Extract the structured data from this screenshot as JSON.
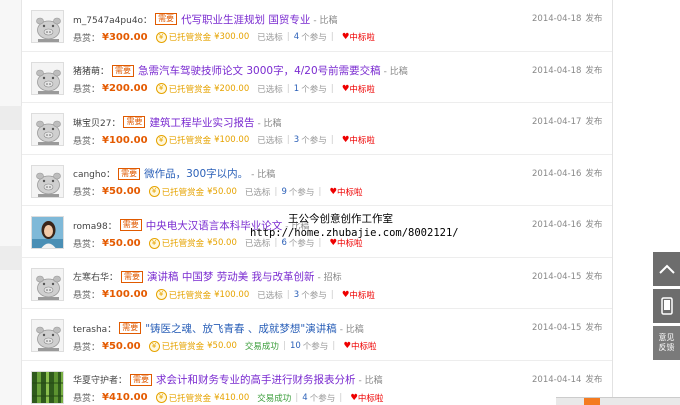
{
  "tasks": [
    {
      "user": "m_7547a4pu4o：",
      "tag": "需要",
      "title": "代写职业生涯规划 国贸专业",
      "status": "- 比稿",
      "date": "2014-04-18",
      "publish": "发布",
      "reward_label": "悬赏：",
      "reward": "¥300.00",
      "escrow": "已托管赏金",
      "escrow_amount": "¥300.00",
      "selection": "已选标",
      "count": "4",
      "count_label": "个参与",
      "heart": "♥",
      "win": "中标啦",
      "title_color": "purple",
      "avatar": "pig"
    },
    {
      "user": "猪猪萌：",
      "tag": "需要",
      "title": "急需汽车驾驶技师论文 3000字，4/20号前需要交稿",
      "status": "- 比稿",
      "date": "2014-04-18",
      "publish": "发布",
      "reward_label": "悬赏：",
      "reward": "¥200.00",
      "escrow": "已托管赏金",
      "escrow_amount": "¥200.00",
      "selection": "已选标",
      "count": "1",
      "count_label": "个参与",
      "heart": "♥",
      "win": "中标啦",
      "title_color": "purple",
      "avatar": "pig"
    },
    {
      "user": "琳宝贝27：",
      "tag": "需要",
      "title": "建筑工程毕业实习报告",
      "status": "- 比稿",
      "date": "2014-04-17",
      "publish": "发布",
      "reward_label": "悬赏：",
      "reward": "¥100.00",
      "escrow": "已托管赏金",
      "escrow_amount": "¥100.00",
      "selection": "已选标",
      "count": "3",
      "count_label": "个参与",
      "heart": "♥",
      "win": "中标啦",
      "title_color": "purple",
      "avatar": "pig"
    },
    {
      "user": "cangho：",
      "tag": "需要",
      "title": "微作品，300字以内。",
      "status": "- 比稿",
      "date": "2014-04-16",
      "publish": "发布",
      "reward_label": "悬赏：",
      "reward": "¥50.00",
      "escrow": "已托管赏金",
      "escrow_amount": "¥50.00",
      "selection": "已选标",
      "count": "9",
      "count_label": "个参与",
      "heart": "♥",
      "win": "中标啦",
      "title_color": "blue",
      "avatar": "pig"
    },
    {
      "user": "roma98：",
      "tag": "需要",
      "title": "中央电大汉语言本科毕业论文",
      "status": "- 比稿",
      "date": "2014-04-16",
      "publish": "发布",
      "reward_label": "悬赏：",
      "reward": "¥50.00",
      "escrow": "已托管赏金",
      "escrow_amount": "¥50.00",
      "selection": "已选标",
      "count": "6",
      "count_label": "个参与",
      "heart": "♥",
      "win": "中标啦",
      "title_color": "purple",
      "avatar": "photo-woman"
    },
    {
      "user": "左寒右华：",
      "tag": "需要",
      "title": "演讲稿 中国梦 劳动美 我与改革创新",
      "status": "- 招标",
      "date": "2014-04-15",
      "publish": "发布",
      "reward_label": "悬赏：",
      "reward": "¥100.00",
      "escrow": "已托管赏金",
      "escrow_amount": "¥100.00",
      "selection": "已选标",
      "count": "3",
      "count_label": "个参与",
      "heart": "♥",
      "win": "中标啦",
      "title_color": "purple",
      "avatar": "pig"
    },
    {
      "user": "terasha：",
      "tag": "需要",
      "title": "\"铸医之魂、放飞青春 、成就梦想\"演讲稿",
      "status": "- 比稿",
      "date": "2014-04-15",
      "publish": "发布",
      "reward_label": "悬赏：",
      "reward": "¥50.00",
      "escrow": "已托管赏金",
      "escrow_amount": "¥50.00",
      "selection": "交易成功",
      "count": "10",
      "count_label": "个参与",
      "heart": "♥",
      "win": "中标啦",
      "title_color": "blue",
      "avatar": "pig"
    },
    {
      "user": "华夏守护者：",
      "tag": "需要",
      "title": "求会计和财务专业的高手进行财务报表分析",
      "status": "- 比稿",
      "date": "2014-04-14",
      "publish": "发布",
      "reward_label": "悬赏：",
      "reward": "¥410.00",
      "escrow": "已托管赏金",
      "escrow_amount": "¥410.00",
      "selection": "交易成功",
      "count": "4",
      "count_label": "个参与",
      "heart": "♥",
      "win": "中标啦",
      "title_color": "purple",
      "avatar": "photo-bamboo"
    }
  ],
  "watermark": {
    "line1": "王公今创意创作工作室",
    "line2": "http://home.zhubajie.com/8002121/"
  },
  "side_tools": {
    "top_icon": "chevron-up-icon",
    "phone_icon": "phone-icon",
    "feedback_line1": "意见",
    "feedback_line2": "反馈"
  },
  "colors": {
    "reward": "#e45a00",
    "escrow": "#e6a300",
    "link": "#2b60b8",
    "title_purple": "#7a2bd0",
    "win": "#ee0000"
  }
}
